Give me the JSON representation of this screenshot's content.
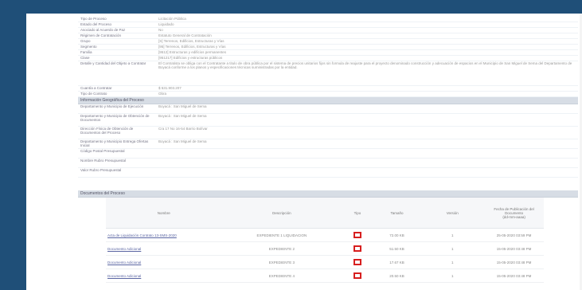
{
  "general": [
    {
      "label": "Tipo de Proceso",
      "value": "Licitación Pública"
    },
    {
      "label": "Estado del Proceso",
      "value": "Liquidado"
    },
    {
      "label": "Asociado al Acuerdo de Paz",
      "value": "No"
    },
    {
      "label": "Régimen de Contratación",
      "value": "Estatuto General de Contratación"
    },
    {
      "label": "Grupo",
      "value": "[S] Terrenos, Edificios, Estructuras y Vías"
    },
    {
      "label": "Segmento",
      "value": "[95] Terrenos, Edificios, Estructuras y Vías"
    },
    {
      "label": "Familia",
      "value": "[9512] Estructuras y edificios permanentes"
    },
    {
      "label": "Clase",
      "value": "[951217] Edificios y estructuras públicos"
    },
    {
      "label": "Detalle y Cantidad del Objeto a Contratar",
      "value": "El Contratista se obliga con el Contratante a titulo de obra pública por el sistema de precios unitarios fijos sin formula de reajuste para el proyecto denominado construcción y adecuación de espacios en el Municipio de San Miguel de Sema del Departamento de Boyacá conforme a los planos y especificaciones técnicas suministradas por la entidad."
    },
    {
      "label": "Cuantía a Contratar",
      "value": "$ 531.903.207"
    },
    {
      "label": "Tipo de Contrato",
      "value": "Obra"
    }
  ],
  "geo_title": "Información Geográfica del Proceso",
  "geo": [
    {
      "label": "Departamento y Municipio de Ejecución",
      "value": "Boyacá : San Miguel de Sema"
    },
    {
      "label": "Departamento y Municipio de Obtención de Documentos",
      "value": "Boyacá : San Miguel de Sema"
    },
    {
      "label": "Dirección Física de Obtención de Documentos del Proceso",
      "value": "Cra 17 No 16-54 Barrio Bolívar"
    },
    {
      "label": "Departamento y Municipio Entrega Ofertas Inicial",
      "value": "Boyacá : San Miguel de Sema"
    },
    {
      "label": "Código Postal Presupuestal",
      "value": ""
    },
    {
      "label": "Nombre Rubro Presupuestal",
      "value": ""
    },
    {
      "label": "Valor Rubro Presupuestal",
      "value": ""
    }
  ],
  "docs_title": "Documentos del Proceso",
  "docs_headers": {
    "name": "Nombre",
    "desc": "Descripción",
    "type": "Tipo",
    "size": "Tamaño",
    "version": "Versión",
    "date": "Fecha de Publicación del Documento",
    "date2": "(dd-mm-aaaa)"
  },
  "docs": [
    {
      "name": "Acta de Liquidación Contrato 13-SMS-2020",
      "desc": "EXPEDIENTE 1 LIQUIDACION",
      "size": "72.00 KB",
      "version": "1",
      "date": "25-05-2020 03:59 PM"
    },
    {
      "name": "Documento Adicional",
      "desc": "EXPEDIENTE 2",
      "size": "51.50 KB",
      "version": "1",
      "date": "15-05-2020 03:48 PM"
    },
    {
      "name": "Documento Adicional",
      "desc": "EXPEDIENTE 3",
      "size": "17.67 KB",
      "version": "1",
      "date": "15-05-2020 03:48 PM"
    },
    {
      "name": "Documento Adicional",
      "desc": "EXPEDIENTE 4",
      "size": "20.50 KB",
      "version": "1",
      "date": "15-05-2020 03:48 PM"
    }
  ]
}
